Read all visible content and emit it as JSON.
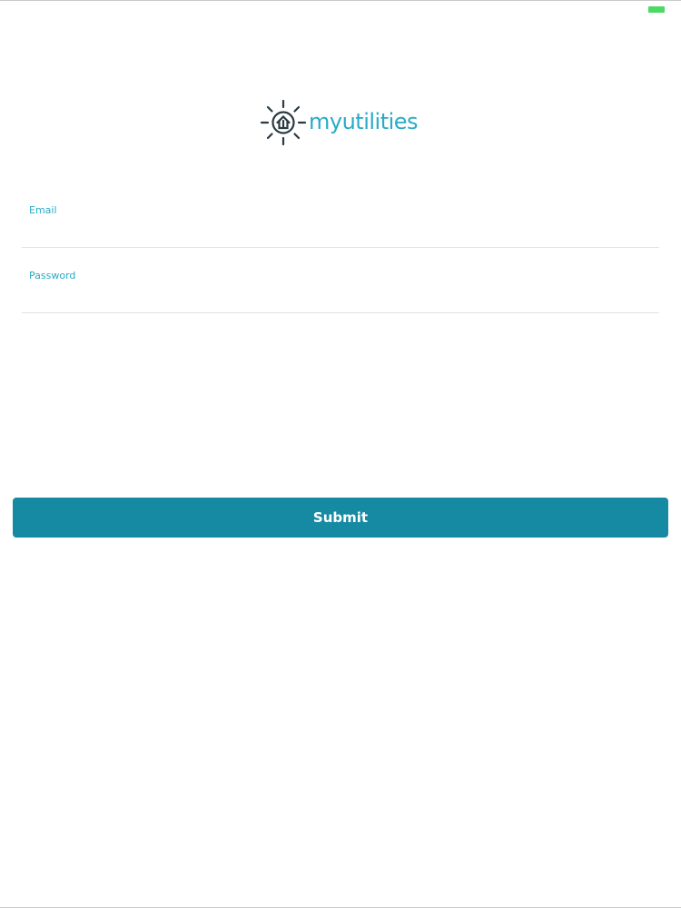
{
  "brand": {
    "name": "myutilities",
    "logo_icon": "sun-house-icon",
    "color": "#29abc6",
    "icon_color": "#2b3a42"
  },
  "status_bar": {
    "battery_icon": "battery-icon",
    "battery_color": "#4cd964"
  },
  "form": {
    "email": {
      "label": "Email",
      "value": ""
    },
    "password": {
      "label": "Password",
      "value": ""
    },
    "submit_label": "Submit",
    "submit_color": "#168aa3"
  }
}
